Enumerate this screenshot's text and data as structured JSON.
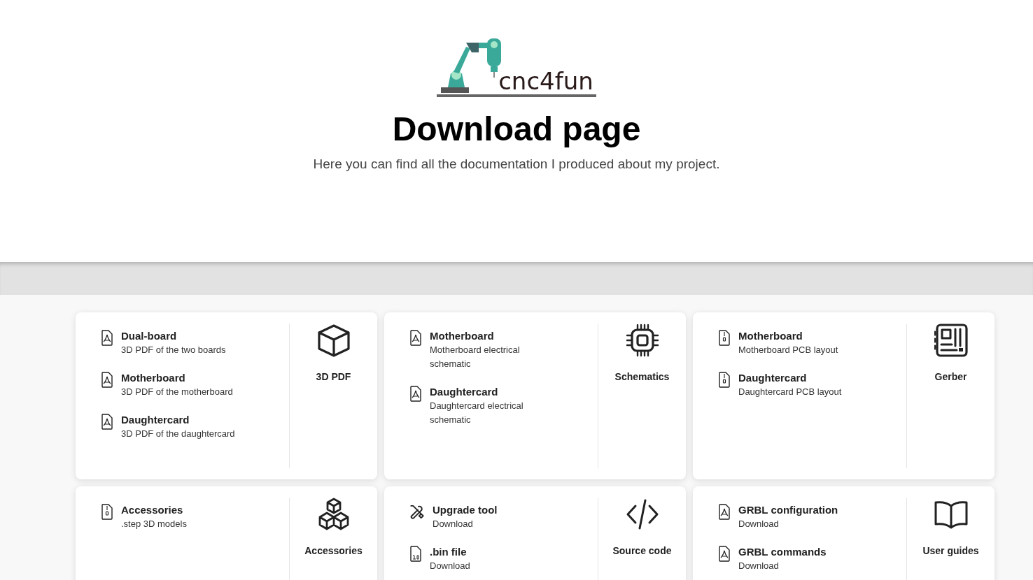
{
  "header": {
    "logo_text": "cnc4fun",
    "title": "Download page",
    "subtitle": "Here you can find all the documentation I produced about my project."
  },
  "cards": [
    {
      "category": "3D PDF",
      "kind": "cube",
      "items": [
        {
          "kind": "pdf",
          "title": "Dual-board",
          "description": "3D PDF of the two boards"
        },
        {
          "kind": "pdf",
          "title": "Motherboard",
          "description": "3D PDF of the motherboard"
        },
        {
          "kind": "pdf",
          "title": "Daughtercard",
          "description": "3D PDF of the daughtercard"
        }
      ]
    },
    {
      "category": "Schematics",
      "kind": "chip",
      "items": [
        {
          "kind": "pdf",
          "title": "Motherboard",
          "description": "Motherboard electrical schematic"
        },
        {
          "kind": "pdf",
          "title": "Daughtercard",
          "description": "Daughtercard electrical schematic"
        }
      ]
    },
    {
      "category": "Gerber",
      "kind": "board",
      "items": [
        {
          "kind": "zip",
          "title": "Motherboard",
          "description": "Motherboard PCB layout"
        },
        {
          "kind": "zip",
          "title": "Daughtercard",
          "description": "Daughtercard PCB layout"
        }
      ]
    },
    {
      "category": "Accessories",
      "kind": "cubes",
      "items": [
        {
          "kind": "zip",
          "title": "Accessories",
          "description": ".step 3D models"
        }
      ]
    },
    {
      "category": "Source code",
      "kind": "code",
      "items": [
        {
          "kind": "tools",
          "title": "Upgrade tool",
          "description": "Download"
        },
        {
          "kind": "binary",
          "title": ".bin file",
          "description": "Download"
        }
      ]
    },
    {
      "category": "User guides",
      "kind": "book",
      "items": [
        {
          "kind": "pdf",
          "title": "GRBL configuration",
          "description": "Download"
        },
        {
          "kind": "pdf",
          "title": "GRBL commands",
          "description": "Download"
        }
      ]
    }
  ]
}
